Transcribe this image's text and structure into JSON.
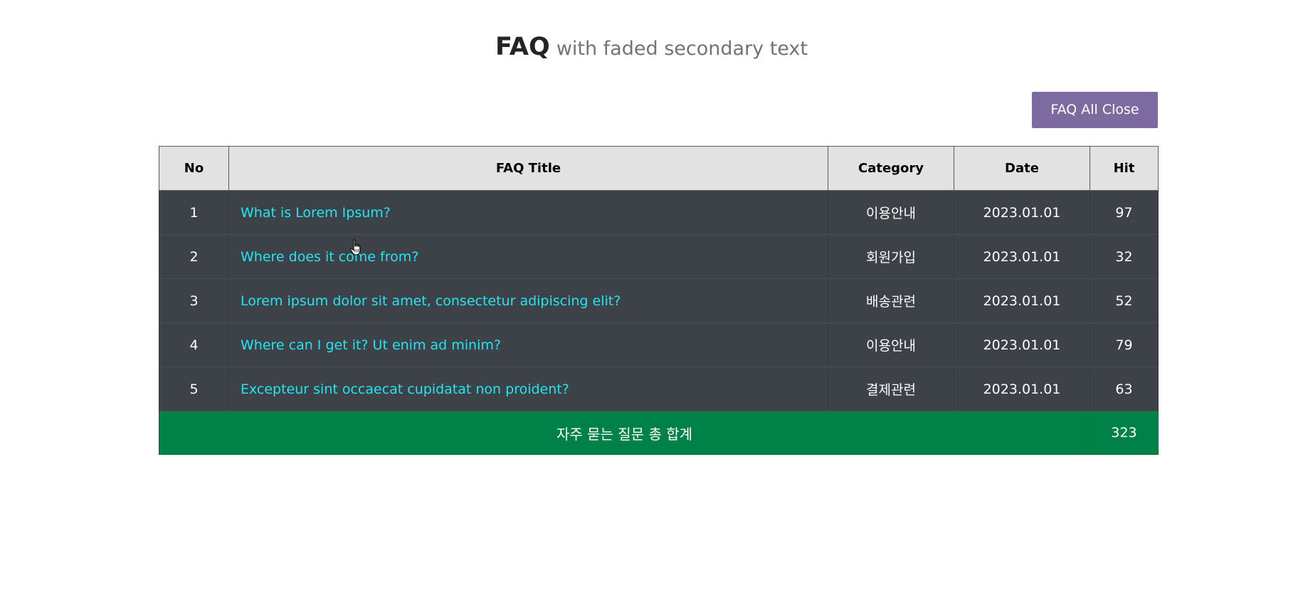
{
  "header": {
    "title": "FAQ",
    "subtitle": "with faded secondary text"
  },
  "toolbar": {
    "close_all_label": "FAQ All Close"
  },
  "table": {
    "columns": [
      "No",
      "FAQ Title",
      "Category",
      "Date",
      "Hit"
    ],
    "rows": [
      {
        "no": "1",
        "title": "What is Lorem Ipsum?",
        "category": "이용안내",
        "date": "2023.01.01",
        "hit": "97"
      },
      {
        "no": "2",
        "title": "Where does it come from?",
        "category": "회원가입",
        "date": "2023.01.01",
        "hit": "32"
      },
      {
        "no": "3",
        "title": "Lorem ipsum dolor sit amet, consectetur adipiscing elit?",
        "category": "배송관련",
        "date": "2023.01.01",
        "hit": "52"
      },
      {
        "no": "4",
        "title": "Where can I get it? Ut enim ad minim?",
        "category": "이용안내",
        "date": "2023.01.01",
        "hit": "79"
      },
      {
        "no": "5",
        "title": "Excepteur sint occaecat cupidatat non proident?",
        "category": "결제관련",
        "date": "2023.01.01",
        "hit": "63"
      }
    ],
    "footer": {
      "label": "자주 묻는 질문 총 합계",
      "total": "323"
    }
  },
  "colors": {
    "button": "#7c6aa0",
    "header_row": "#e2e2e2",
    "body_row": "#3d4148",
    "link": "#23e5f0",
    "footer_row": "#008148"
  },
  "icons": {
    "cursor": "hand-pointer-icon"
  }
}
